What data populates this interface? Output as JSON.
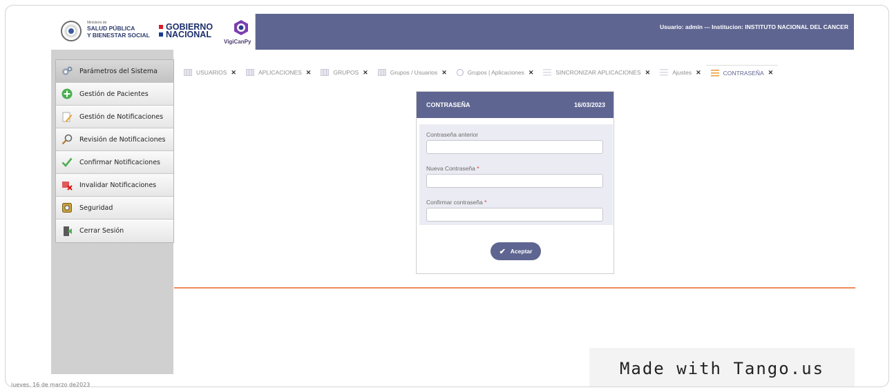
{
  "header": {
    "ministry_small": "Ministerio de",
    "ministry_line1": "SALUD PÚBLICA",
    "ministry_line2": "Y BIENESTAR SOCIAL",
    "gob_line1": "GOBIERNO",
    "gob_line2": "NACIONAL",
    "app_name": "VigiCanPy",
    "user_info": "Usuario: admin --- Institucion: INSTITUTO NACIONAL DEL CANCER",
    "colors": {
      "header_bg": "#5e6591",
      "accent_line": "#ef8a5a"
    }
  },
  "sidebar": {
    "items": [
      {
        "label": "Parámetros del Sistema",
        "icon": "gears-icon"
      },
      {
        "label": "Gestión de Pacientes",
        "icon": "plus-circle-icon"
      },
      {
        "label": "Gestión de Notificaciones",
        "icon": "pencil-icon"
      },
      {
        "label": "Revisión de Notificaciones",
        "icon": "magnifier-icon"
      },
      {
        "label": "Confirmar Notificaciones",
        "icon": "checkmark-icon"
      },
      {
        "label": "Invalidar Notificaciones",
        "icon": "invalidate-icon"
      },
      {
        "label": "Seguridad",
        "icon": "safe-icon"
      },
      {
        "label": "Cerrar Sesión",
        "icon": "logout-icon"
      }
    ],
    "footer_date": "jueves, 16 de marzo de2023"
  },
  "tabs": [
    {
      "label": "USUARIOS",
      "icon": "table-icon"
    },
    {
      "label": "APLICACIONES",
      "icon": "table-icon"
    },
    {
      "label": "GRUPOS",
      "icon": "table-icon"
    },
    {
      "label": "Grupos / Usuarios",
      "icon": "table-icon"
    },
    {
      "label": "Grupos | Aplicaciones",
      "icon": "search-icon"
    },
    {
      "label": "SINCRONIZAR APLICACIONES",
      "icon": "sliders-icon"
    },
    {
      "label": "Ajustes",
      "icon": "sliders-icon"
    },
    {
      "label": "CONTRASEÑA",
      "icon": "sliders-icon",
      "active": true
    }
  ],
  "tab_close": "✕",
  "form": {
    "title": "CONTRASEÑA",
    "date": "16/03/2023",
    "fields": [
      {
        "label": "Contraseña anterior",
        "required": false,
        "value": ""
      },
      {
        "label": "Nueva Contraseña",
        "required": true,
        "value": ""
      },
      {
        "label": "Confirmar contraseña",
        "required": true,
        "value": ""
      }
    ],
    "required_mark": "*",
    "submit_label": "Aceptar"
  },
  "watermark": "Made with Tango.us"
}
